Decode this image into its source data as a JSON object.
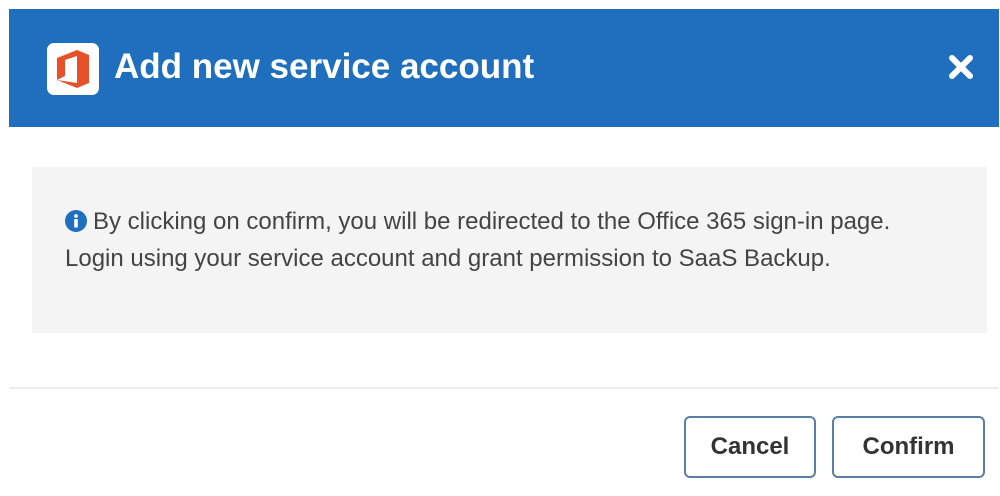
{
  "dialog": {
    "title": "Add new service account",
    "icon": "office-365-icon",
    "close_icon": "close-icon",
    "header_color": "#1f6fbe"
  },
  "info": {
    "icon": "info-circle-icon",
    "message": "By clicking on confirm, you will be redirected to the Office 365 sign-in page. Login using your service account and grant permission to SaaS Backup."
  },
  "footer": {
    "cancel_label": "Cancel",
    "confirm_label": "Confirm"
  }
}
